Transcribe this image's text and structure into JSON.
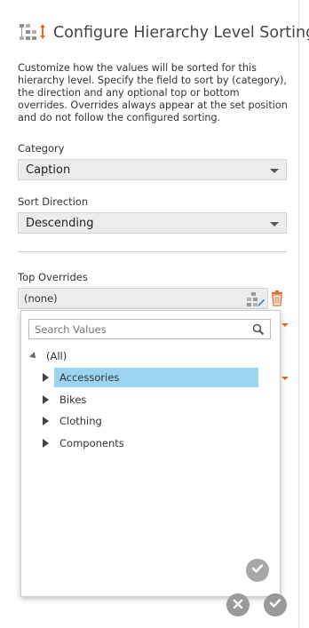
{
  "dialog": {
    "title": "Configure Hierarchy Level Sorting",
    "description": "Customize how the values will be sorted for this hierarchy level. Specify the field to sort by (category), the direction and any optional top or bottom overrides. Overrides always appear at the set position and do not follow the configured sorting."
  },
  "category": {
    "label": "Category",
    "value": "Caption"
  },
  "sort_direction": {
    "label": "Sort Direction",
    "value": "Descending"
  },
  "top_overrides": {
    "label": "Top Overrides",
    "value": "(none)"
  },
  "popup": {
    "search_placeholder": "Search Values",
    "root_label": "(All)",
    "items": [
      {
        "label": "Accessories",
        "selected": true
      },
      {
        "label": "Bikes",
        "selected": false
      },
      {
        "label": "Clothing",
        "selected": false
      },
      {
        "label": "Components",
        "selected": false
      }
    ]
  },
  "icons": {
    "title": "hierarchy-sort-icon",
    "override_hierarchy": "hierarchy-icon",
    "delete": "trash-icon",
    "search": "search-icon",
    "popup_confirm": "check-icon",
    "cancel": "close-icon",
    "ok": "check-icon"
  },
  "colors": {
    "accent_orange": "#e26a2c",
    "selection_blue": "#9ad4f1",
    "field_bg": "#ececec",
    "button_gray": "#a7a7a7"
  }
}
